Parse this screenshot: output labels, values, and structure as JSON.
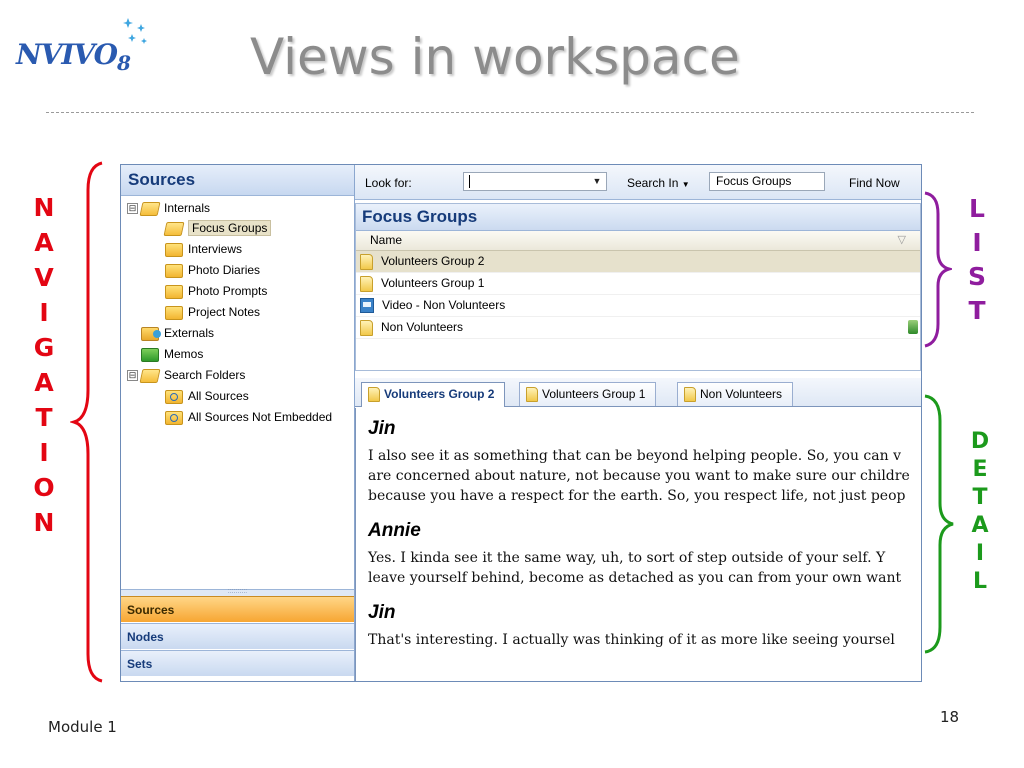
{
  "logo": {
    "text": "NVIVO",
    "version": "8"
  },
  "slide": {
    "title": "Views in workspace",
    "footer": "Module 1",
    "page_number": "18"
  },
  "annotations": {
    "navigation": [
      "N",
      "A",
      "V",
      "I",
      "G",
      "A",
      "T",
      "I",
      "O",
      "N"
    ],
    "list": [
      "L",
      "I",
      "S",
      "T"
    ],
    "detail": [
      "D",
      "E",
      "T",
      "A",
      "I",
      "L"
    ],
    "colors": {
      "navigation": "#e30613",
      "list": "#8f1d9e",
      "detail": "#1c9a1c"
    }
  },
  "nav": {
    "title": "Sources",
    "tree": [
      {
        "label": "Internals",
        "icon": "open-folder-icon",
        "toggle": "⊟"
      },
      {
        "label": "Focus Groups",
        "icon": "open-folder-icon",
        "selected": true
      },
      {
        "label": "Interviews",
        "icon": "folder-icon"
      },
      {
        "label": "Photo Diaries",
        "icon": "folder-icon"
      },
      {
        "label": "Photo Prompts",
        "icon": "folder-icon"
      },
      {
        "label": "Project Notes",
        "icon": "folder-icon"
      },
      {
        "label": "Externals",
        "icon": "externals-folder-icon"
      },
      {
        "label": "Memos",
        "icon": "memos-folder-icon"
      },
      {
        "label": "Search Folders",
        "icon": "open-folder-icon",
        "toggle": "⊟"
      },
      {
        "label": "All Sources",
        "icon": "search-folder-icon"
      },
      {
        "label": "All Sources Not Embedded",
        "icon": "search-folder-icon"
      }
    ],
    "grip": "::::::::::",
    "buttons": [
      "Sources",
      "Nodes",
      "Sets"
    ]
  },
  "find_bar": {
    "look_for_label": "Look for:",
    "look_for_value": "",
    "search_in_label": "Search In",
    "search_in_value": "Focus Groups",
    "find_now_label": "Find Now"
  },
  "list": {
    "title": "Focus Groups",
    "column": "Name",
    "rows": [
      {
        "name": "Volunteers Group 2",
        "icon": "document-icon"
      },
      {
        "name": "Volunteers Group 1",
        "icon": "document-icon"
      },
      {
        "name": "Video - Non Volunteers",
        "icon": "video-icon"
      },
      {
        "name": "Non Volunteers",
        "icon": "document-icon"
      }
    ]
  },
  "detail": {
    "tabs": [
      "Volunteers Group 2",
      "Volunteers Group 1",
      "Non Volunteers"
    ],
    "transcript": [
      {
        "speaker": "Jin",
        "lines": [
          "I also see it as something that can be beyond helping people.  So, you can v",
          "are concerned about nature, not because you want to make sure our childre",
          "because you have a respect for the earth.  So, you respect life, not just peop"
        ]
      },
      {
        "speaker": "Annie",
        "lines": [
          "Yes.  I kinda see it the same way, uh, to sort of step outside of your self.  Y",
          "leave yourself behind, become as detached as you can from your own want"
        ]
      },
      {
        "speaker": "Jin",
        "lines": [
          "That's interesting.  I actually was thinking of it as more like seeing yoursel"
        ]
      }
    ]
  }
}
